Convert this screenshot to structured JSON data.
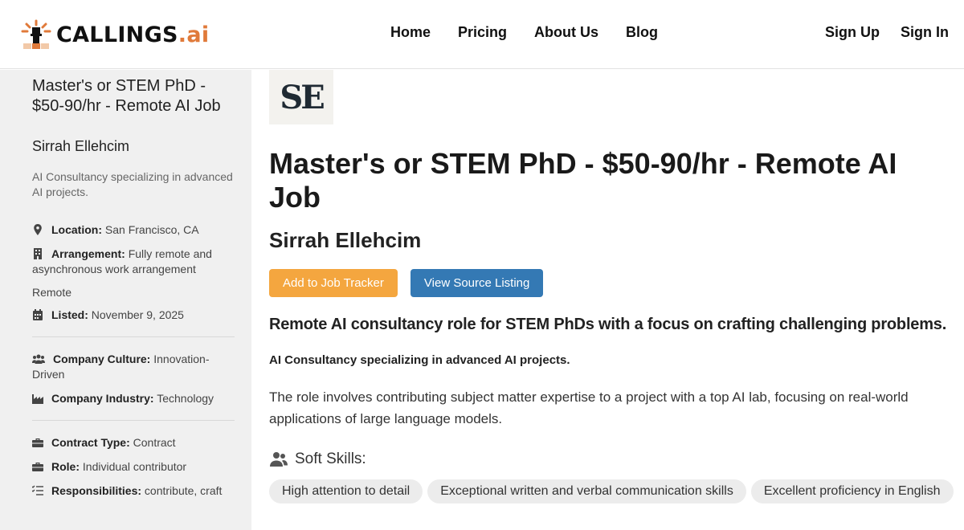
{
  "brand": {
    "name": "CALLINGS",
    "suffix": ".ai",
    "accent": "#e07a3a"
  },
  "nav": {
    "items": [
      "Home",
      "Pricing",
      "About Us",
      "Blog"
    ]
  },
  "auth": {
    "signup": "Sign Up",
    "signin": "Sign In"
  },
  "sidebar": {
    "title": "Master's or STEM PhD - $50-90/hr - Remote AI Job",
    "company": "Sirrah Ellehcim",
    "description": "AI Consultancy specializing in advanced AI projects.",
    "location_label": "Location:",
    "location_value": "San Francisco, CA",
    "arrangement_label": "Arrangement:",
    "arrangement_value": "Fully remote and asynchronous work arrangement",
    "remote": "Remote",
    "listed_label": "Listed:",
    "listed_value": "November 9, 2025",
    "culture_label": "Company Culture:",
    "culture_value": "Innovation-Driven",
    "industry_label": "Company Industry:",
    "industry_value": "Technology",
    "contract_label": "Contract Type:",
    "contract_value": "Contract",
    "role_label": "Role:",
    "role_value": "Individual contributor",
    "responsibilities_label": "Responsibilities:",
    "responsibilities_value": "contribute, craft"
  },
  "main": {
    "logo_text": "SE",
    "title": "Master's or STEM PhD - $50-90/hr - Remote AI Job",
    "company": "Sirrah Ellehcim",
    "add_button": "Add to Job Tracker",
    "source_button": "View Source Listing",
    "summary": "Remote AI consultancy role for STEM PhDs with a focus on crafting challenging problems.",
    "tagline": "AI Consultancy specializing in advanced AI projects.",
    "paragraph": "The role involves contributing subject matter expertise to a project with a top AI lab, focusing on real-world applications of large language models.",
    "soft_skills_label": "Soft Skills:",
    "soft_skills": [
      "High attention to detail",
      "Exceptional written and verbal communication skills",
      "Excellent proficiency in English"
    ]
  },
  "colors": {
    "orange_button": "#f4a63f",
    "blue_button": "#3479b4",
    "sidebar_bg": "#f0f0f0"
  }
}
